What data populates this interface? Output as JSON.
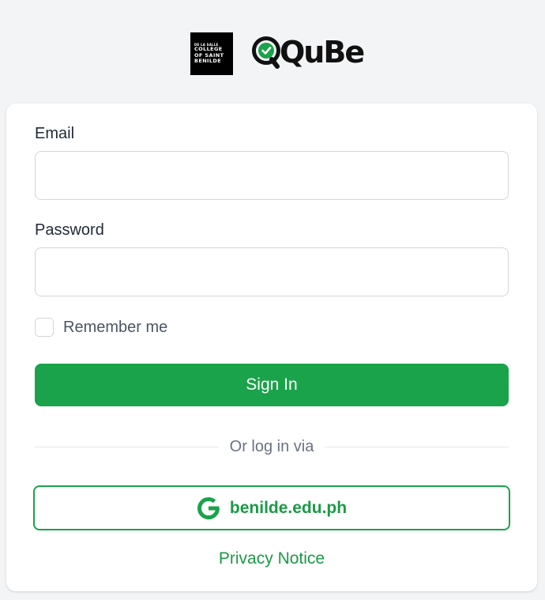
{
  "header": {
    "institution_logo_lines": [
      "DE LA SALLE",
      "COLLEGE",
      "OF SAINT",
      "BENILDE"
    ],
    "app_logo_text": "QuBe"
  },
  "form": {
    "email_label": "Email",
    "email_value": "",
    "password_label": "Password",
    "password_value": "",
    "remember_label": "Remember me",
    "remember_checked": false,
    "sign_in_label": "Sign In",
    "divider_text": "Or log in via",
    "google_button_label": "benilde.edu.ph",
    "privacy_link": "Privacy Notice"
  },
  "colors": {
    "primary_green": "#1aa34a",
    "page_background": "#f3f4f6"
  },
  "icons": {
    "app_logo_mark": "check-magnifier-icon",
    "google_button": "google-g-icon"
  }
}
